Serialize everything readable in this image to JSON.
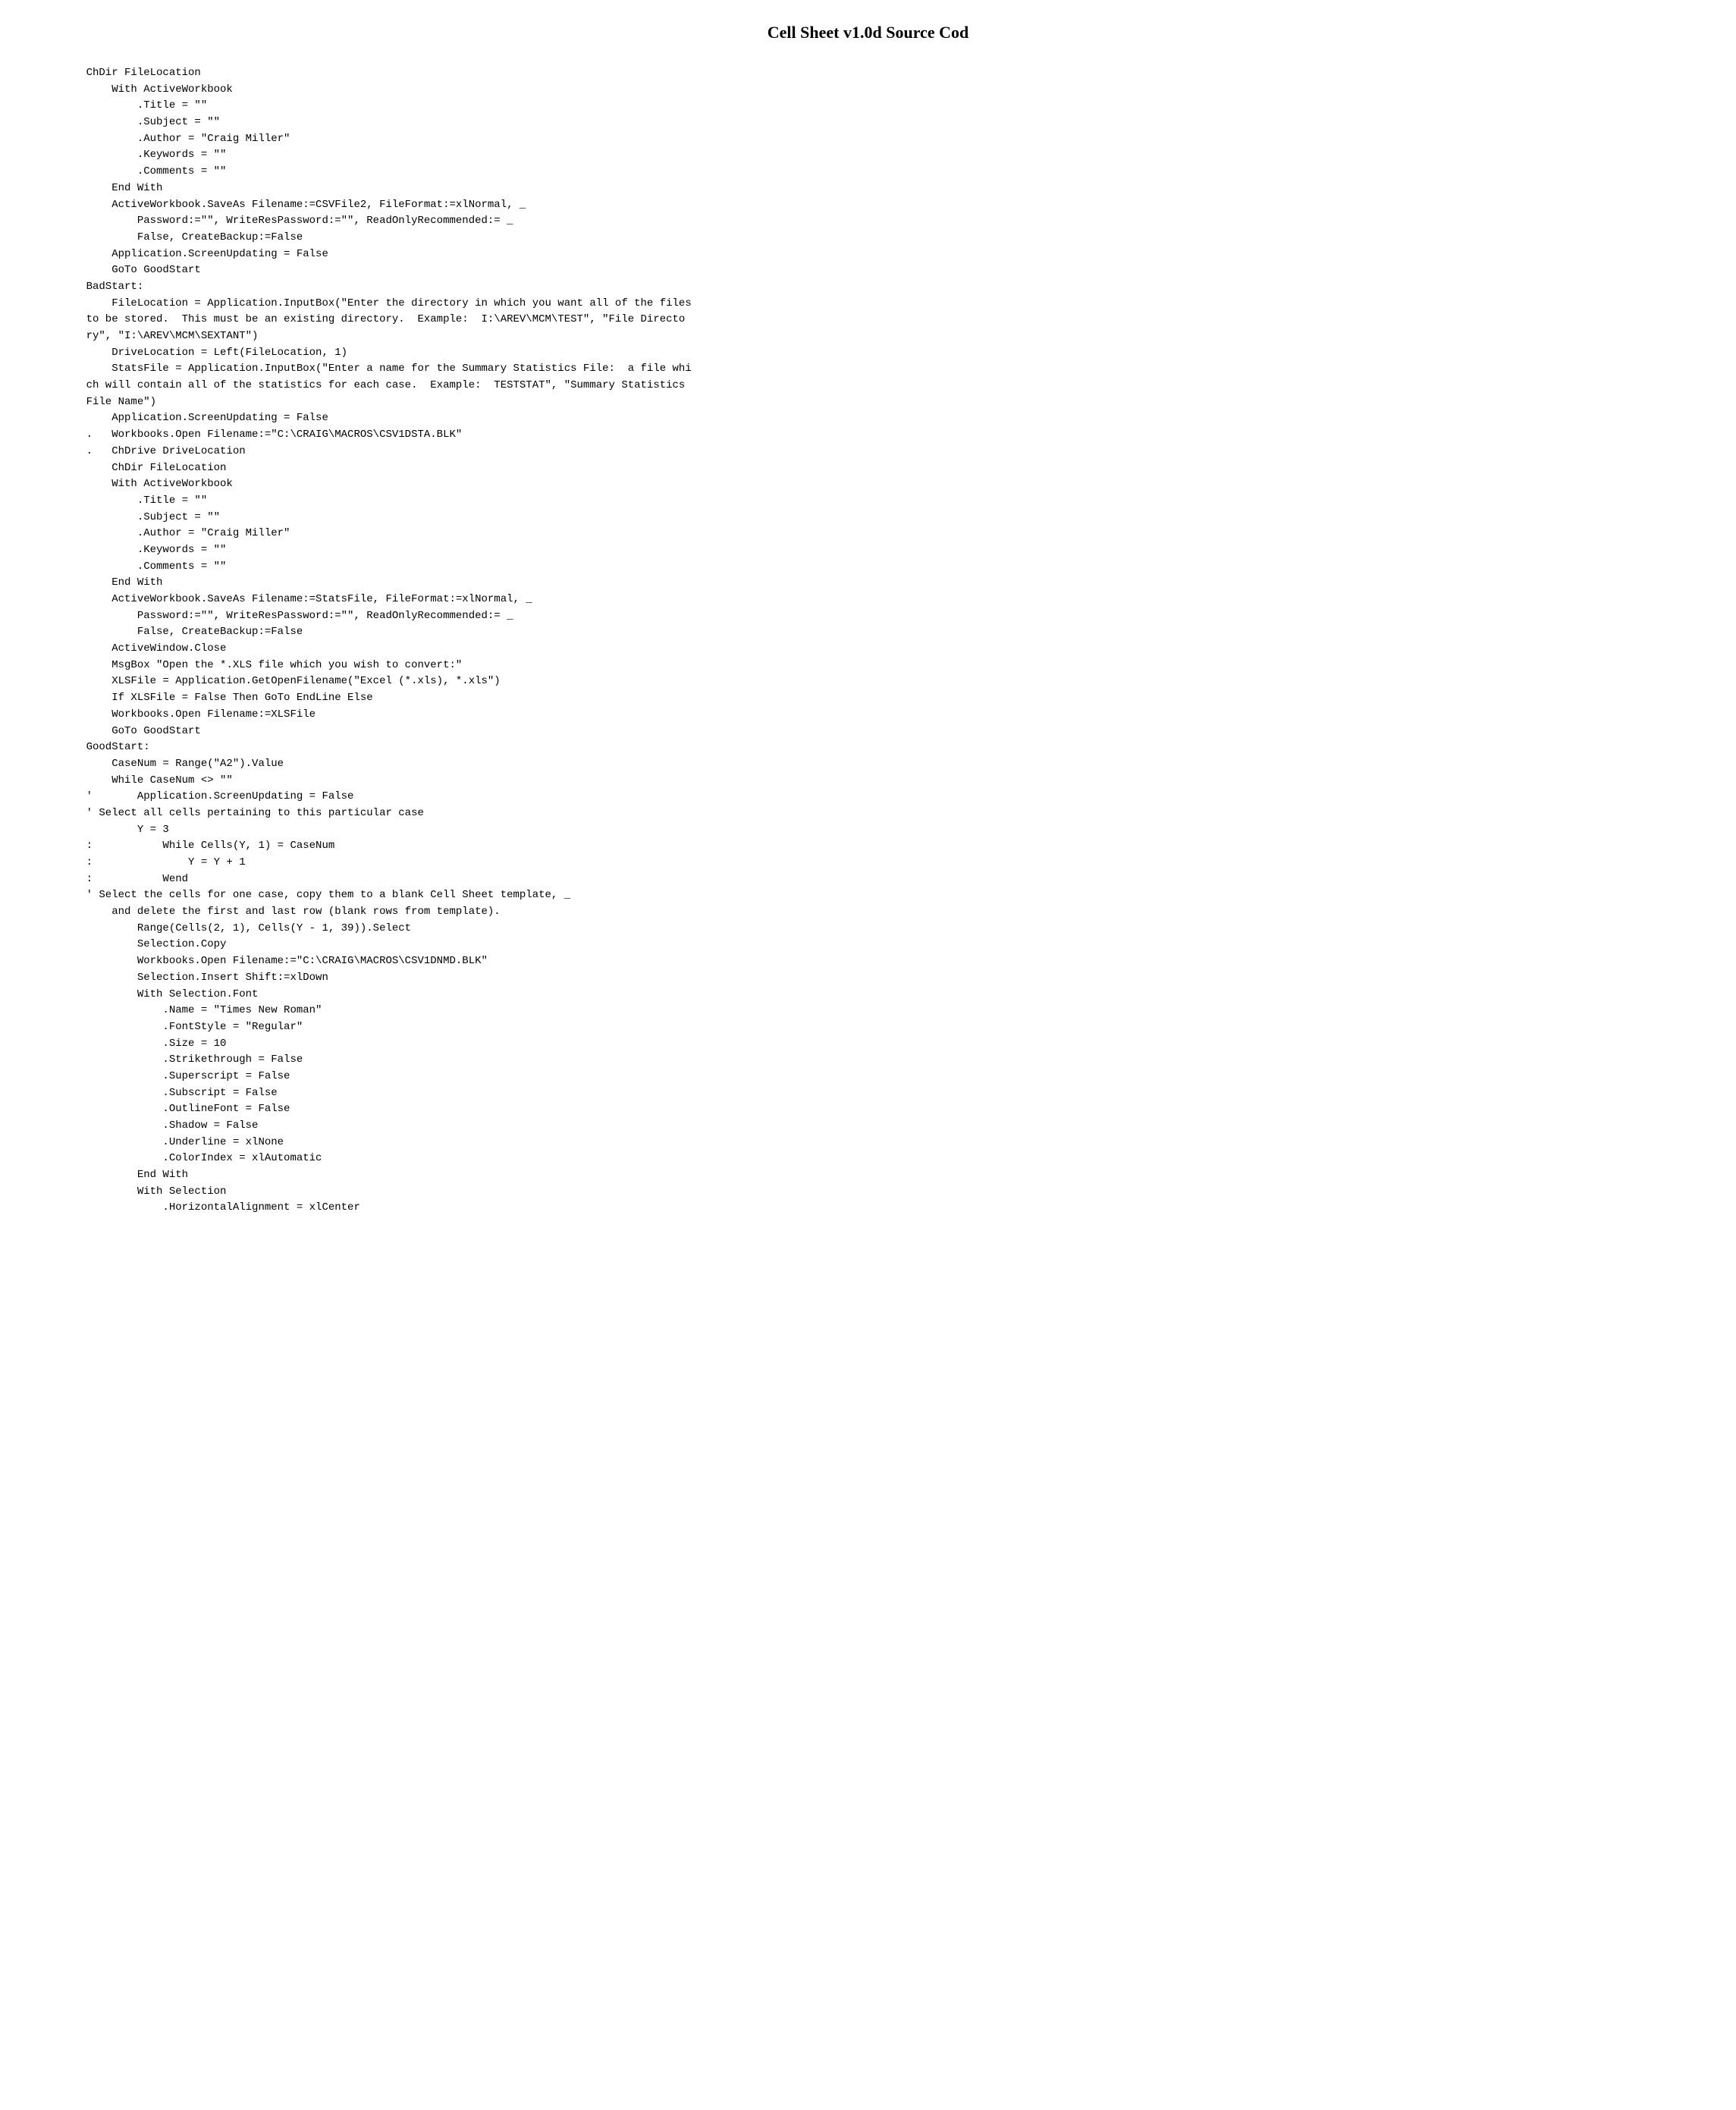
{
  "page": {
    "title": "Cell Sheet v1.0d Source Cod",
    "code_lines": [
      "",
      "",
      "    ChDir FileLocation",
      "        With ActiveWorkbook",
      "            .Title = \"\"",
      "            .Subject = \"\"",
      "            .Author = \"Craig Miller\"",
      "            .Keywords = \"\"",
      "            .Comments = \"\"",
      "        End With",
      "        ActiveWorkbook.SaveAs Filename:=CSVFile2, FileFormat:=xlNormal, _",
      "            Password:=\"\", WriteResPassword:=\"\", ReadOnlyRecommended:= _",
      "            False, CreateBackup:=False",
      "        Application.ScreenUpdating = False",
      "        GoTo GoodStart",
      "    BadStart:",
      "        FileLocation = Application.InputBox(\"Enter the directory in which you want all of the files",
      "    to be stored.  This must be an existing directory.  Example:  I:\\AREV\\MCM\\TEST\", \"File Directo",
      "    ry\", \"I:\\AREV\\MCM\\SEXTANT\")",
      "        DriveLocation = Left(FileLocation, 1)",
      "        StatsFile = Application.InputBox(\"Enter a name for the Summary Statistics File:  a file whi",
      "    ch will contain all of the statistics for each case.  Example:  TESTSTAT\", \"Summary Statistics",
      "    File Name\")",
      "        Application.ScreenUpdating = False",
      "    .   Workbooks.Open Filename:=\"C:\\CRAIG\\MACROS\\CSV1DSTA.BLK\"",
      "    .   ChDrive DriveLocation",
      "        ChDir FileLocation",
      "        With ActiveWorkbook",
      "            .Title = \"\"",
      "            .Subject = \"\"",
      "            .Author = \"Craig Miller\"",
      "            .Keywords = \"\"",
      "            .Comments = \"\"",
      "        End With",
      "        ActiveWorkbook.SaveAs Filename:=StatsFile, FileFormat:=xlNormal, _",
      "            Password:=\"\", WriteResPassword:=\"\", ReadOnlyRecommended:= _",
      "            False, CreateBackup:=False",
      "        ActiveWindow.Close",
      "        MsgBox \"Open the *.XLS file which you wish to convert:\"",
      "        XLSFile = Application.GetOpenFilename(\"Excel (*.xls), *.xls\")",
      "        If XLSFile = False Then GoTo EndLine Else",
      "        Workbooks.Open Filename:=XLSFile",
      "        GoTo GoodStart",
      "    GoodStart:",
      "        CaseNum = Range(\"A2\").Value",
      "        While CaseNum <> \"\"",
      "    '       Application.ScreenUpdating = False",
      "    ' Select all cells pertaining to this particular case",
      "            Y = 3",
      "    :           While Cells(Y, 1) = CaseNum",
      "    :               Y = Y + 1",
      "    :           Wend",
      "    ' Select the cells for one case, copy them to a blank Cell Sheet template, _",
      "        and delete the first and last row (blank rows from template).",
      "            Range(Cells(2, 1), Cells(Y - 1, 39)).Select",
      "            Selection.Copy",
      "            Workbooks.Open Filename:=\"C:\\CRAIG\\MACROS\\CSV1DNMD.BLK\"",
      "            Selection.Insert Shift:=xlDown",
      "            With Selection.Font",
      "                .Name = \"Times New Roman\"",
      "                .FontStyle = \"Regular\"",
      "                .Size = 10",
      "                .Strikethrough = False",
      "                .Superscript = False",
      "                .Subscript = False",
      "                .OutlineFont = False",
      "                .Shadow = False",
      "                .Underline = xlNone",
      "                .ColorIndex = xlAutomatic",
      "            End With",
      "            With Selection",
      "                .HorizontalAlignment = xlCenter"
    ]
  }
}
